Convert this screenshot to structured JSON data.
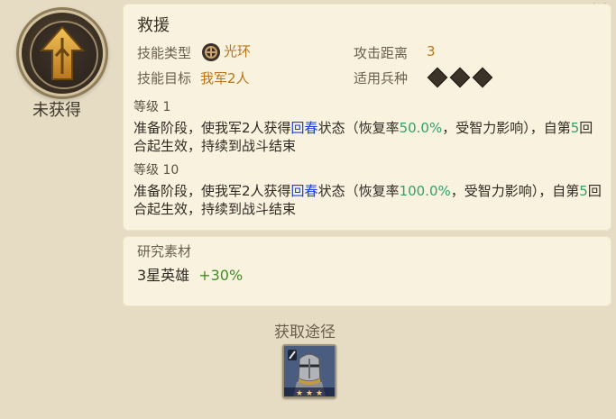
{
  "skill": {
    "status": "未获得",
    "name": "救援",
    "type_label": "技能类型",
    "type_value": "光环",
    "range_label": "攻击距离",
    "range_value": "3",
    "target_label": "技能目标",
    "target_value": "我军2人",
    "troops_label": "适用兵种",
    "troop_icons": [
      "sword-icon",
      "horse-icon",
      "bow-icon"
    ]
  },
  "levels": [
    {
      "level_label": "等级 1",
      "desc_prefix": "准备阶段，使我军2人获得",
      "desc_keyword": "回春",
      "desc_mid": "状态（恢复率",
      "desc_rate": "50.0%",
      "desc_after_rate": "，受智力影响），自第",
      "desc_round": "5",
      "desc_suffix": "回合起生效，持续到战斗结束"
    },
    {
      "level_label": "等级 10",
      "desc_prefix": "准备阶段，使我军2人获得",
      "desc_keyword": "回春",
      "desc_mid": "状态（恢复率",
      "desc_rate": "100.0%",
      "desc_after_rate": "，受智力影响），自第",
      "desc_round": "5",
      "desc_suffix": "回合起生效，持续到战斗结束"
    }
  ],
  "research": {
    "title": "研究素材",
    "item": "3星英雄",
    "bonus": "+30%"
  },
  "source": {
    "title": "获取途径",
    "hero_stars": 3
  },
  "colors": {
    "keyword": "#1c3fd1",
    "rate": "#2ea36d",
    "gold": "#b8751a",
    "bonus": "#3f8f23"
  }
}
